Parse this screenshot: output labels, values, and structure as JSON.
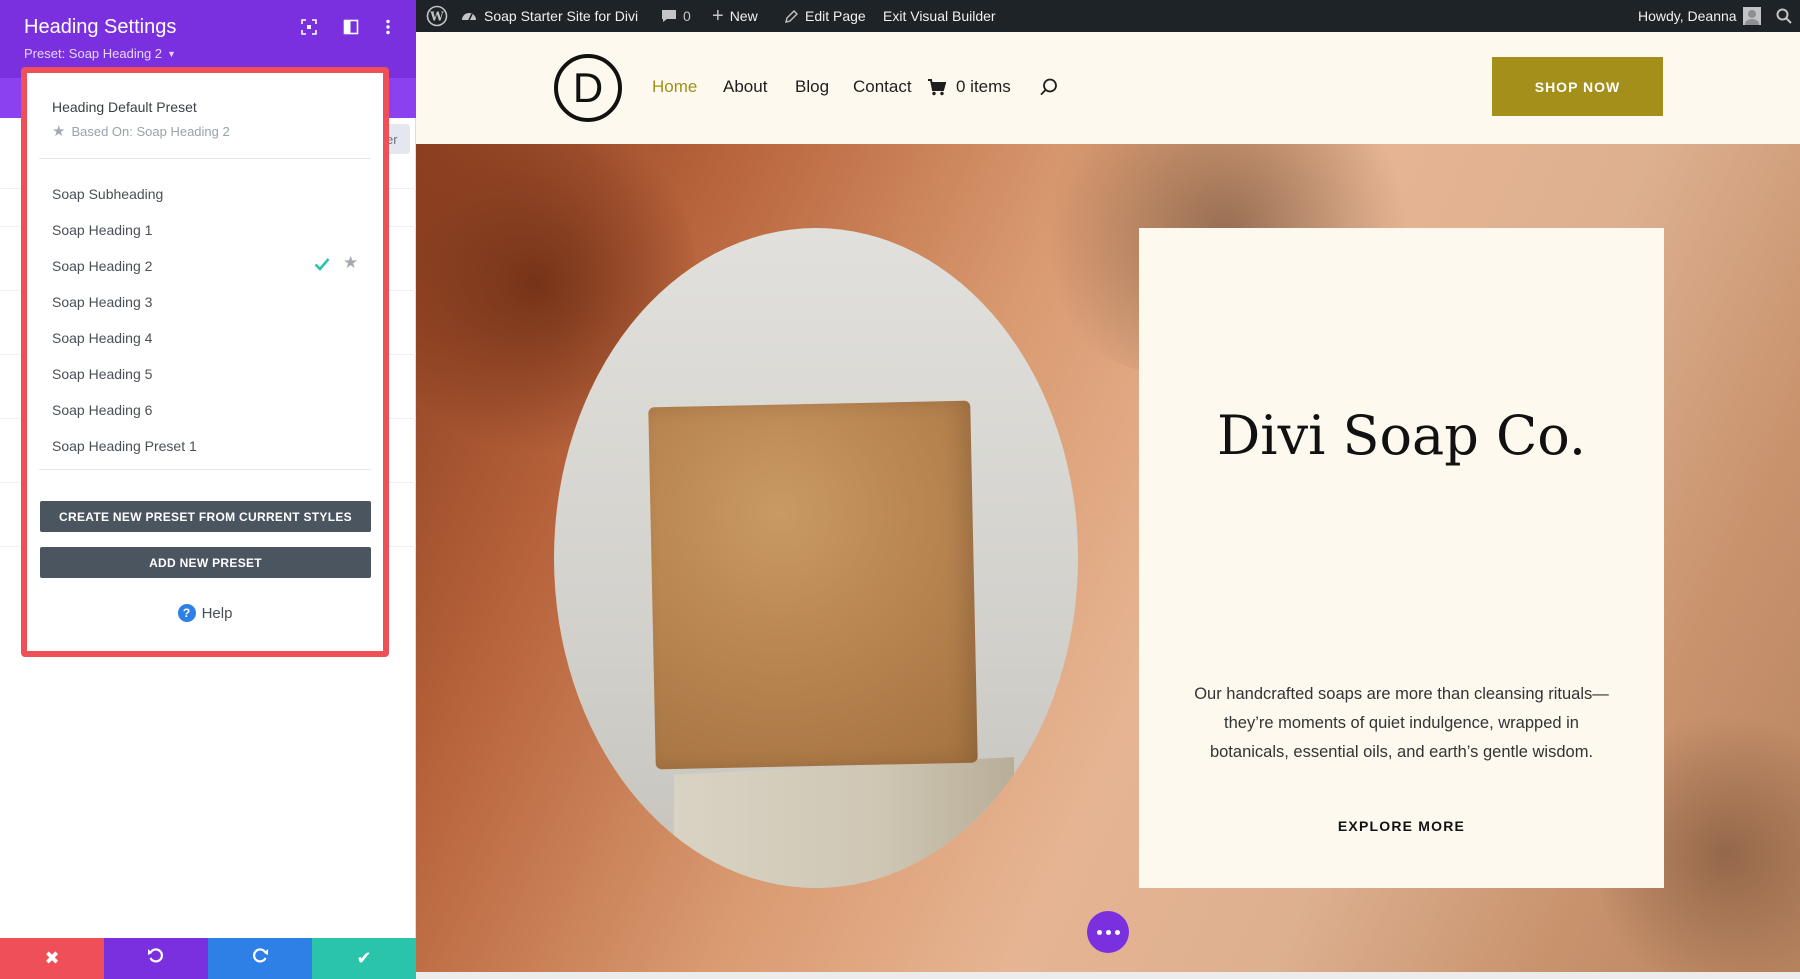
{
  "admin_bar": {
    "site_name": "Soap Starter Site for Divi",
    "comments_count": "0",
    "new_label": "New",
    "edit_page_label": "Edit Page",
    "exit_builder_label": "Exit Visual Builder",
    "howdy_label": "Howdy, Deanna"
  },
  "site": {
    "logo_letter": "D",
    "nav": {
      "home": "Home",
      "about": "About",
      "blog": "Blog",
      "contact": "Contact",
      "cart": "0 items"
    },
    "shop_now": "SHOP NOW",
    "accent_color": "#a38f1a"
  },
  "hero": {
    "heading": "Divi Soap Co.",
    "body": "Our handcrafted soaps are more than cleansing rituals—they’re moments of quiet indulgence, wrapped in botanicals, essential oils, and earth’s gentle wisdom.",
    "cta": "EXPLORE MORE"
  },
  "settings_panel": {
    "title": "Heading Settings",
    "preset_label": "Preset: Soap Heading 2",
    "partial_tab_text": "er",
    "header_color": "#7b30e0",
    "dropdown": {
      "default_preset": "Heading Default Preset",
      "based_on": "Based On: Soap Heading 2",
      "presets": [
        "Soap Subheading",
        "Soap Heading 1",
        "Soap Heading 2",
        "Soap Heading 3",
        "Soap Heading 4",
        "Soap Heading 5",
        "Soap Heading 6",
        "Soap Heading Preset 1"
      ],
      "active_preset": "Soap Heading 2",
      "create_button": "CREATE NEW PRESET FROM CURRENT STYLES",
      "add_button": "ADD NEW PRESET",
      "help": "Help",
      "highlight_color": "#ef4f57"
    },
    "footer_colors": {
      "cancel": "#ef4f57",
      "undo": "#7b30e0",
      "redo": "#2e80e6",
      "save": "#29c4a9"
    }
  }
}
